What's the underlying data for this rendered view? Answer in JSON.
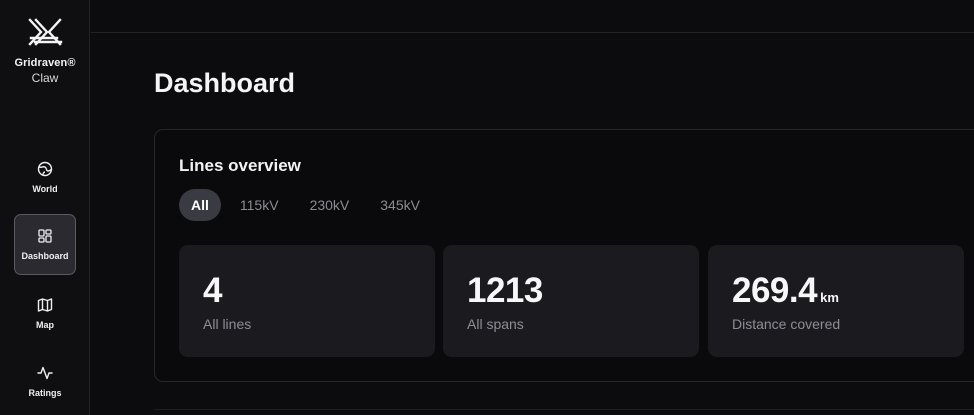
{
  "brand": {
    "name": "Gridraven®",
    "sub": "Claw"
  },
  "nav": [
    {
      "label": "World",
      "icon": "globe-icon"
    },
    {
      "label": "Dashboard",
      "icon": "dashboard-grid-icon",
      "active": true
    },
    {
      "label": "Map",
      "icon": "map-icon"
    },
    {
      "label": "Ratings",
      "icon": "activity-icon"
    }
  ],
  "page": {
    "title": "Dashboard"
  },
  "overview": {
    "title": "Lines overview",
    "filters": [
      "All",
      "115kV",
      "230kV",
      "345kV"
    ],
    "selected_filter": "All",
    "stats": [
      {
        "value": "4",
        "unit": "",
        "caption": "All lines"
      },
      {
        "value": "1213",
        "unit": "",
        "caption": "All spans"
      },
      {
        "value": "269.4",
        "unit": "km",
        "caption": "Distance covered"
      }
    ]
  }
}
